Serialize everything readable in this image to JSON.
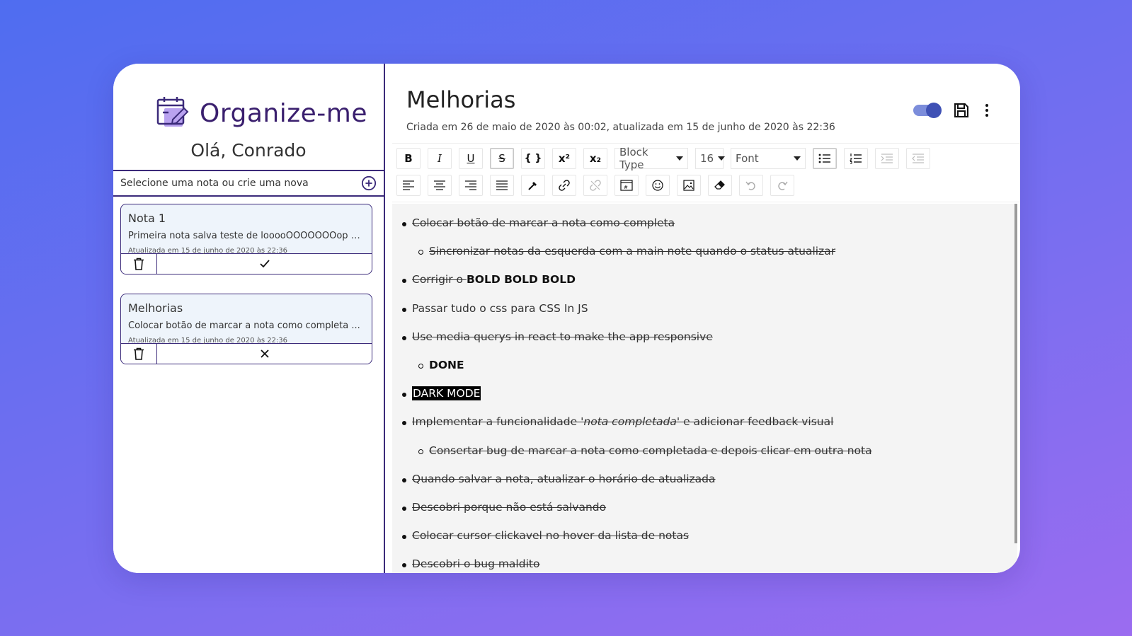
{
  "app": {
    "name": "Organize-me",
    "greeting": "Olá, Conrado",
    "search_placeholder": "Selecione uma nota ou crie uma nova"
  },
  "notes": [
    {
      "title": "Nota 1",
      "preview": "Primeira nota salva teste de looooOOOOOOOop V...",
      "updated": "Atualizada em 15 de junho de 2020 às 22:36",
      "status_icon": "check-icon"
    },
    {
      "title": "Melhorias",
      "preview": "Colocar botão de marcar a nota como completa ...",
      "updated": "Atualizada em 15 de junho de 2020 às 22:36",
      "status_icon": "close-icon"
    }
  ],
  "editor": {
    "title": "Melhorias",
    "meta": "Criada em 26 de maio de 2020 às 00:02, atualizada em 15 de junho de 2020 às 22:36",
    "toolbar": {
      "bold": "B",
      "italic": "I",
      "underline": "U",
      "strike": "S",
      "code": "{ }",
      "superscript": "x²",
      "subscript": "x₂",
      "block_type": "Block Type",
      "font_size": "16",
      "font": "Font"
    },
    "items": [
      {
        "text": "Colocar botão de marcar a nota como completa"
      },
      {
        "text": "Sincronizar notas da esquerda com a main note quando o status atualizar"
      },
      {
        "prefix": "Corrigir o ",
        "bold": "BOLD BOLD BOLD"
      },
      {
        "text": "Passar tudo o css para CSS In JS"
      },
      {
        "text": "Use media querys in react to make the app responsive "
      },
      {
        "text": "DONE"
      },
      {
        "text": "DARK MODE"
      },
      {
        "prefix": "Implementar a funcionalidade '",
        "italic": "nota completada",
        "suffix": "' e adicionar feedback visual"
      },
      {
        "text": "Consertar bug de marcar a nota como completada e depois clicar em outra nota"
      },
      {
        "text": "Quando salvar a nota, atualizar o horário de atualizada"
      },
      {
        "text": "Descobri porque não está salvando"
      },
      {
        "text": "Colocar cursor clickavel no hover da lista de notas"
      },
      {
        "text": "Descobri o bug maldito"
      }
    ]
  },
  "colors": {
    "accent": "#3b2a7a",
    "toggle": "#3f51b5",
    "brand_text": "#3a1f6e"
  }
}
